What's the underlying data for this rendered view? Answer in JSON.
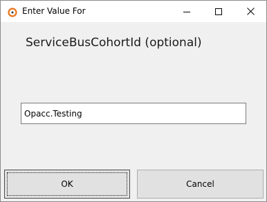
{
  "window": {
    "title": "Enter Value For",
    "icon": "app-ring-icon",
    "controls": {
      "minimize": "minimize-icon",
      "maximize": "maximize-icon",
      "close": "close-icon"
    }
  },
  "prompt": {
    "label": "ServiceBusCohortId (optional)"
  },
  "input": {
    "value": "Opacc.Testing"
  },
  "buttons": {
    "ok_label": "OK",
    "cancel_label": "Cancel"
  },
  "colors": {
    "accent_icon": "#e8731a",
    "dialog_bg": "#f0f0f0",
    "titlebar_bg": "#ffffff",
    "button_bg": "#e1e1e1"
  }
}
